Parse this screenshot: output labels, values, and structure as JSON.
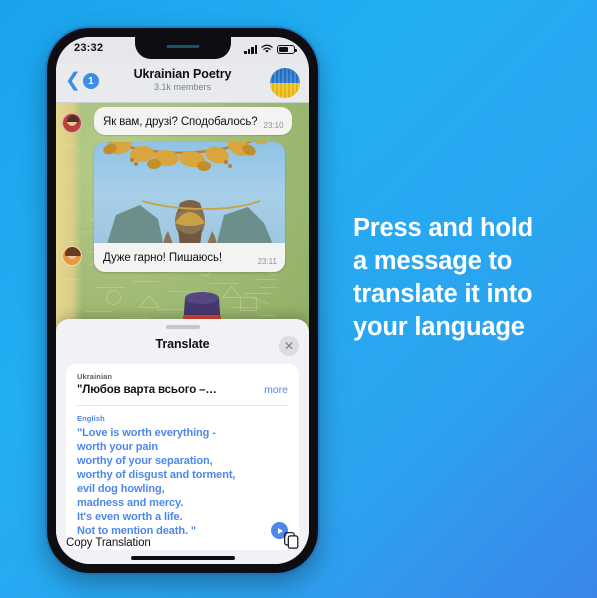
{
  "promo": {
    "lines": [
      "Press and hold",
      "a message to",
      "translate it into",
      "your language"
    ],
    "color": "#ffffff"
  },
  "background": {
    "accent": "#22aef3",
    "gradient_end": "#3b86e8"
  },
  "phone": {
    "status_bar": {
      "time": "23:32",
      "signal_icon": "signal-bars-icon",
      "wifi_icon": "wifi-icon",
      "battery_icon": "battery-icon"
    },
    "chat_header": {
      "back_icon": "chevron-left-icon",
      "unread_count": "1",
      "title": "Ukrainian Poetry",
      "subtitle": "3.1k members",
      "avatar_name": "ukrainian-flag-avatar"
    },
    "messages": [
      {
        "avatar": "sender-avatar-1",
        "text": "Як вам, друзі? Сподобалось?",
        "time": "23:10"
      },
      {
        "avatar": "sender-avatar-2",
        "text": "Дуже гарно! Пишаюсь!",
        "time": "23:11",
        "photo": "statue-photo"
      }
    ],
    "sticker": "purple-top-hat-sticker"
  },
  "translate_sheet": {
    "title": "Translate",
    "close_icon": "close-icon",
    "source": {
      "language": "Ukrainian",
      "text": "\"Любов варта всього –…",
      "more_label": "more"
    },
    "target": {
      "language": "English",
      "lines": [
        "\"Love is worth everything -",
        "worth your pain",
        "worthy of your separation,",
        "worthy of disgust and torment,",
        "evil dog howling,",
        "madness and mercy.",
        "It's even worth a life.",
        "Not to mention death. \""
      ],
      "play_icon": "play-icon"
    },
    "copy": {
      "label": "Copy Translation",
      "icon": "copy-icon"
    },
    "accent_color": "#4d87ec"
  }
}
